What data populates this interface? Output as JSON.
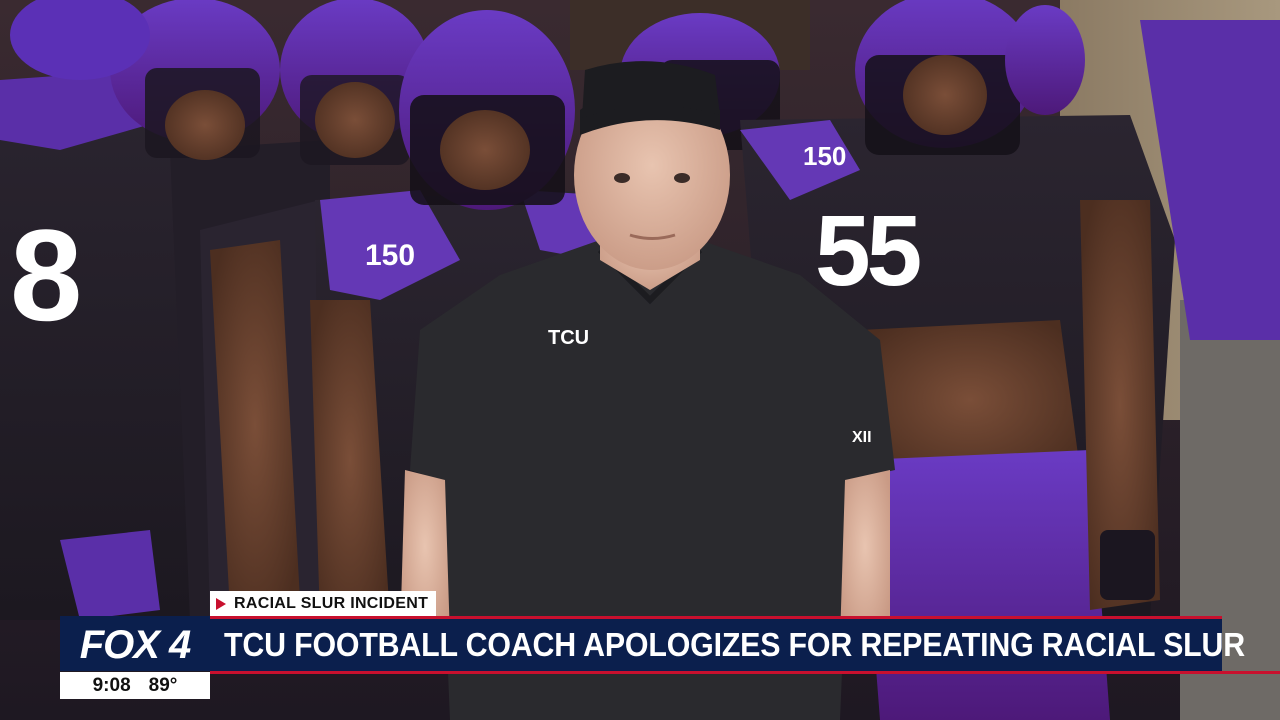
{
  "broadcast": {
    "category_tag": "RACIAL SLUR INCIDENT",
    "headline": "TCU FOOTBALL COACH APOLOGIZES FOR REPEATING RACIAL SLUR",
    "station_logo": "FOX 4",
    "time": "9:08",
    "temperature": "89°"
  },
  "scene": {
    "jersey_numbers": [
      "8",
      "55"
    ],
    "shirt_logo": "TCU",
    "patch_text": "150"
  },
  "colors": {
    "bar_navy": "#0b1f4d",
    "accent_red": "#c8102e",
    "team_purple": "#4d1979"
  }
}
